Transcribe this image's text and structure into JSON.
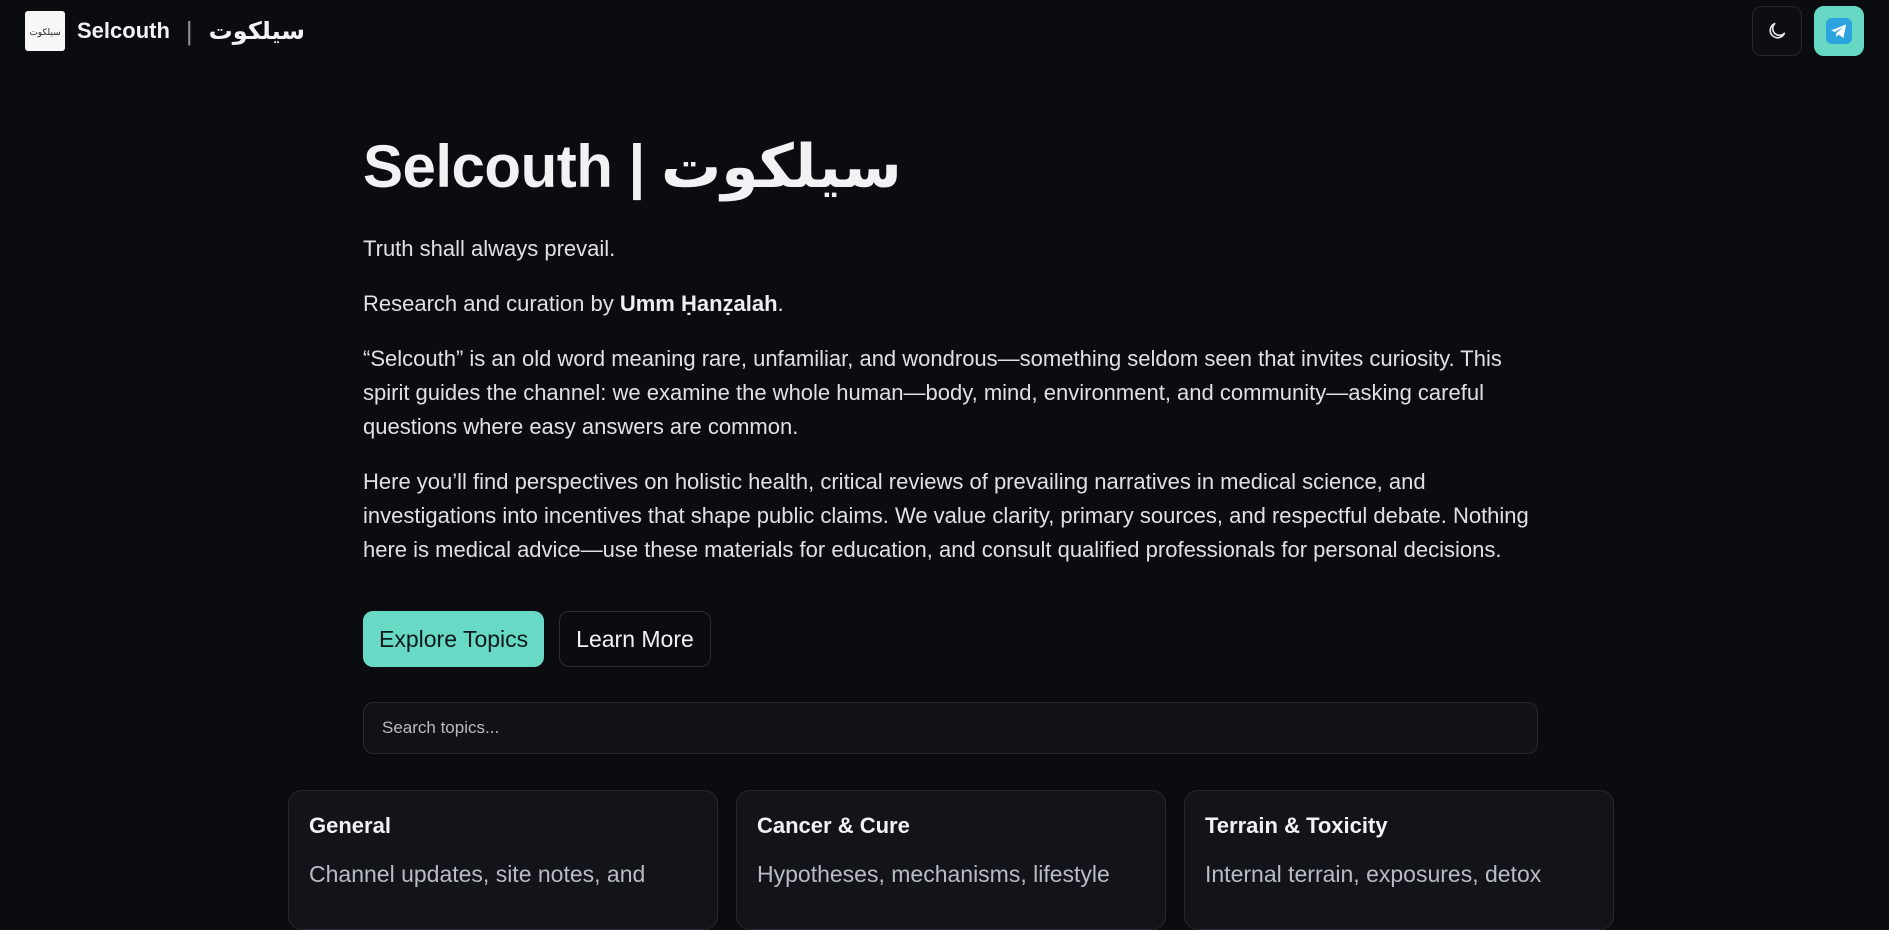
{
  "header": {
    "brand_name": "Selcouth",
    "separator": "|",
    "brand_arabic": "سیلکوت",
    "logo_text": "سیلکوت"
  },
  "hero": {
    "title_latin": "Selcouth",
    "title_separator": "|",
    "title_arabic": "سیلکوت",
    "tagline": "Truth shall always prevail.",
    "byline_prefix": "Research and curation by ",
    "byline_author": "Umm Ḥanẓalah",
    "byline_suffix": ".",
    "description_1": "“Selcouth” is an old word meaning rare, unfamiliar, and wondrous—something seldom seen that invites curiosity. This spirit guides the channel: we examine the whole human—body, mind, environment, and community—asking careful questions where easy answers are common.",
    "description_2": "Here you’ll find perspectives on holistic health, critical reviews of prevailing narratives in medical science, and investigations into incentives that shape public claims. We value clarity, primary sources, and respectful debate. Nothing here is medical advice—use these materials for education, and consult qualified professionals for personal decisions."
  },
  "buttons": {
    "explore": "Explore Topics",
    "learn_more": "Learn More"
  },
  "search": {
    "placeholder": "Search topics..."
  },
  "cards": [
    {
      "title": "General",
      "description": "Channel updates, site notes, and"
    },
    {
      "title": "Cancer & Cure",
      "description": "Hypotheses, mechanisms, lifestyle"
    },
    {
      "title": "Terrain & Toxicity",
      "description": "Internal terrain, exposures, detox"
    }
  ],
  "colors": {
    "background": "#0b0c10",
    "accent": "#67d9c5",
    "card_bg": "#12141a",
    "border": "#262932"
  },
  "icons": {
    "theme_toggle": "moon-icon",
    "social": "telegram-icon"
  }
}
